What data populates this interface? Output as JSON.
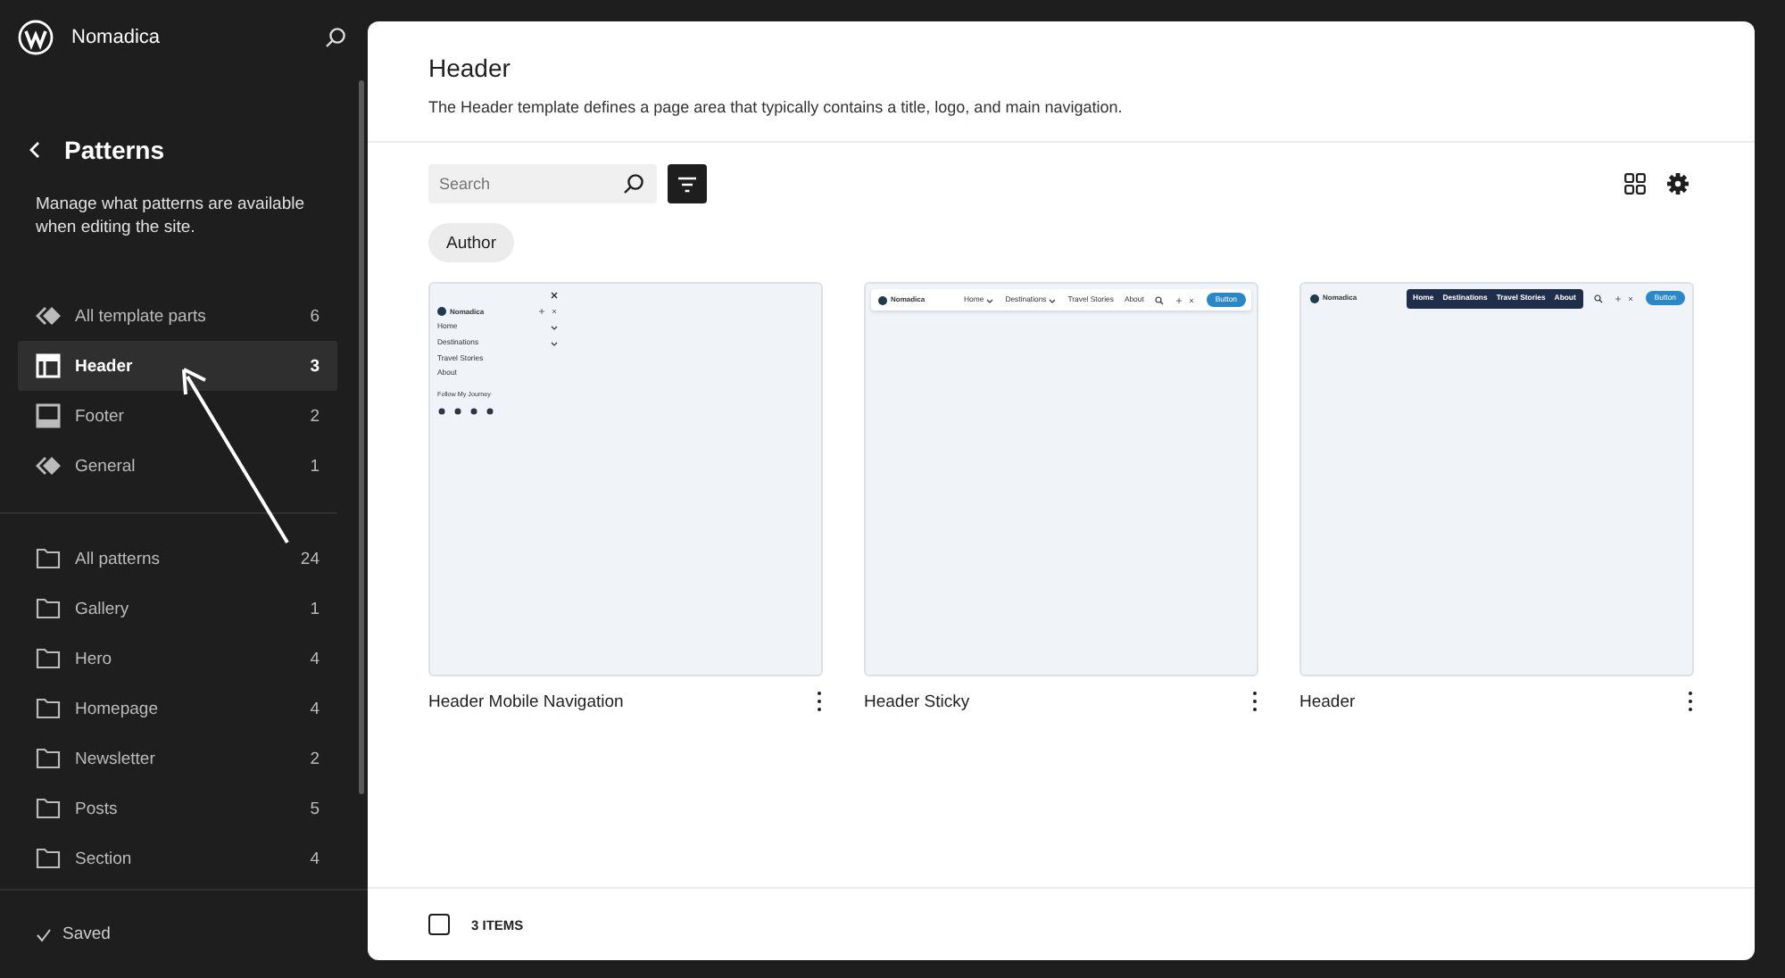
{
  "site": {
    "name": "Nomadica"
  },
  "sidebar": {
    "title": "Patterns",
    "description": "Manage what patterns are available when editing the site.",
    "template_parts": [
      {
        "kind": "parts",
        "label": "All template parts",
        "count": "6",
        "selected": false
      },
      {
        "kind": "header",
        "label": "Header",
        "count": "3",
        "selected": true
      },
      {
        "kind": "footer",
        "label": "Footer",
        "count": "2",
        "selected": false
      },
      {
        "kind": "parts",
        "label": "General",
        "count": "1",
        "selected": false
      }
    ],
    "categories": [
      {
        "label": "All patterns",
        "count": "24"
      },
      {
        "label": "Gallery",
        "count": "1"
      },
      {
        "label": "Hero",
        "count": "4"
      },
      {
        "label": "Homepage",
        "count": "4"
      },
      {
        "label": "Newsletter",
        "count": "2"
      },
      {
        "label": "Posts",
        "count": "5"
      },
      {
        "label": "Section",
        "count": "4"
      }
    ],
    "status": "Saved"
  },
  "main": {
    "title": "Header",
    "description": "The Header template defines a page area that typically contains a title, logo, and main navigation.",
    "search": {
      "placeholder": "Search"
    },
    "filter_chip": "Author",
    "patterns": [
      {
        "title": "Header Mobile Navigation",
        "preview": {
          "kind": "mobile",
          "logo": "Nomadica",
          "menu": [
            "Home",
            "Destinations",
            "Travel Stories",
            "About"
          ],
          "follow": "Follow My Journey"
        }
      },
      {
        "title": "Header Sticky",
        "preview": {
          "kind": "bar",
          "logo": "Nomadica",
          "menu": [
            "Home",
            "Destinations",
            "Travel Stories",
            "About"
          ],
          "button": "Button"
        }
      },
      {
        "title": "Header",
        "preview": {
          "kind": "dark-menu",
          "logo": "Nomadica",
          "menu": [
            "Home",
            "Destinations",
            "Travel Stories",
            "About"
          ],
          "button": "Button"
        }
      }
    ],
    "footer": {
      "count": "3 ITEMS",
      "select_all": {
        "checked": false
      }
    }
  }
}
